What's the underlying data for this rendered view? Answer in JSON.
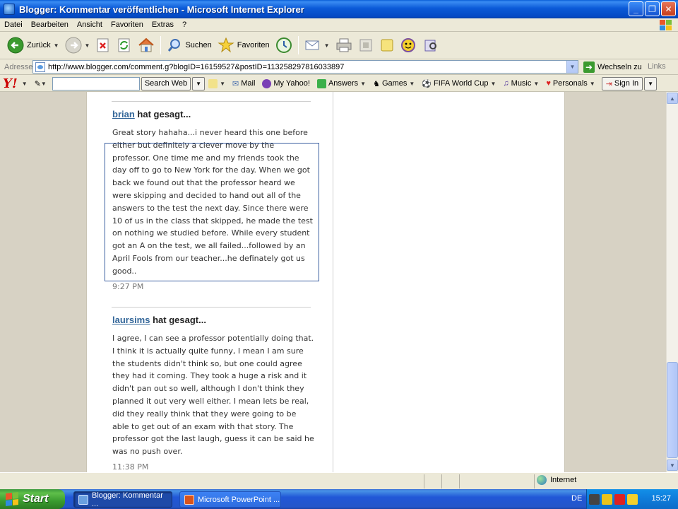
{
  "window": {
    "title": "Blogger: Kommentar veröffentlichen - Microsoft Internet Explorer"
  },
  "menubar": {
    "items": [
      "Datei",
      "Bearbeiten",
      "Ansicht",
      "Favoriten",
      "Extras",
      "?"
    ]
  },
  "toolbar": {
    "back_label": "Zurück",
    "search_label": "Suchen",
    "favorites_label": "Favoriten"
  },
  "addressbar": {
    "label": "Adresse",
    "url": "http://www.blogger.com/comment.g?blogID=16159527&postID=113258297816033897",
    "go_label": "Wechseln zu",
    "links_label": "Links"
  },
  "yahoo_toolbar": {
    "search_button": "Search Web",
    "items": [
      "Mail",
      "My Yahoo!",
      "Answers",
      "Games",
      "FIFA World Cup",
      "Music",
      "Personals",
      "Sign In"
    ]
  },
  "comments": [
    {
      "author": "brian",
      "said": "hat gesagt...",
      "body": "Great story hahaha...i never heard this one before either but definitely a clever move by the professor. One time me and my friends took the day off to go to New York for the day. When we got back we found out that the professor heard we were skipping and decided to hand out all of the answers to the test the next day. Since there were 10 of us in the class that skipped, he made the test on nothing we studied before. While every student got an A on the test, we all failed...followed by an April Fools from our teacher...he definately got us good..",
      "time": "9:27 PM"
    },
    {
      "author": "laursims",
      "said": "hat gesagt...",
      "body": "I agree, I can see a professor potentially doing that. I think it is actually quite funny, I mean I am sure the students didn't think so, but one could agree they had it coming. They took a huge a risk and it didn't pan out so well, although I don't think they planned it out very well either. I mean lets be real, did they really think that they were going to be able to get out of an exam with that story. The professor got the last laugh, guess it can be said he was no push over.",
      "time": "11:38 PM"
    }
  ],
  "statusbar": {
    "zone": "Internet"
  },
  "taskbar": {
    "start_label": "Start",
    "tasks": [
      "Blogger: Kommentar ...",
      "Microsoft PowerPoint ..."
    ],
    "language": "DE",
    "clock": "15:27"
  }
}
